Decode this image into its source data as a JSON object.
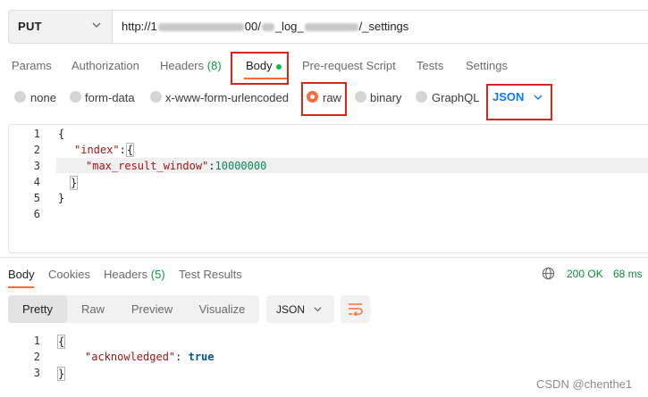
{
  "request": {
    "method": "PUT",
    "url_prefix": "http://1",
    "url_mid1": "00/",
    "url_mid2": "_log_",
    "url_suffix": "/_settings"
  },
  "request_tabs": [
    {
      "label": "Params"
    },
    {
      "label": "Authorization"
    },
    {
      "label": "Headers",
      "count": "(8)"
    },
    {
      "label": "Body"
    },
    {
      "label": "Pre-request Script"
    },
    {
      "label": "Tests"
    },
    {
      "label": "Settings"
    }
  ],
  "body_types": [
    "none",
    "form-data",
    "x-www-form-urlencoded",
    "raw",
    "binary",
    "GraphQL"
  ],
  "body_format": "JSON",
  "request_body": {
    "line_numbers": [
      "1",
      "2",
      "3",
      "4",
      "5",
      "6"
    ],
    "key_index": "\"index\"",
    "key_setting": "\"max_result_window\"",
    "setting_value": "10000000"
  },
  "response_tabs": [
    {
      "label": "Body"
    },
    {
      "label": "Cookies"
    },
    {
      "label": "Headers",
      "count": "(5)"
    },
    {
      "label": "Test Results"
    }
  ],
  "response_status": {
    "code": "200 OK",
    "time": "68 ms"
  },
  "view_modes": [
    "Pretty",
    "Raw",
    "Preview",
    "Visualize"
  ],
  "response_format": "JSON",
  "response_body": {
    "line_numbers": [
      "1",
      "2",
      "3"
    ],
    "key": "\"acknowledged\"",
    "value": "true"
  },
  "watermark": "CSDN @chenthe1",
  "colors": {
    "accent": "#ff6c37",
    "highlight": "#d9261c",
    "link": "#097bed",
    "success": "#0b8a3d"
  }
}
